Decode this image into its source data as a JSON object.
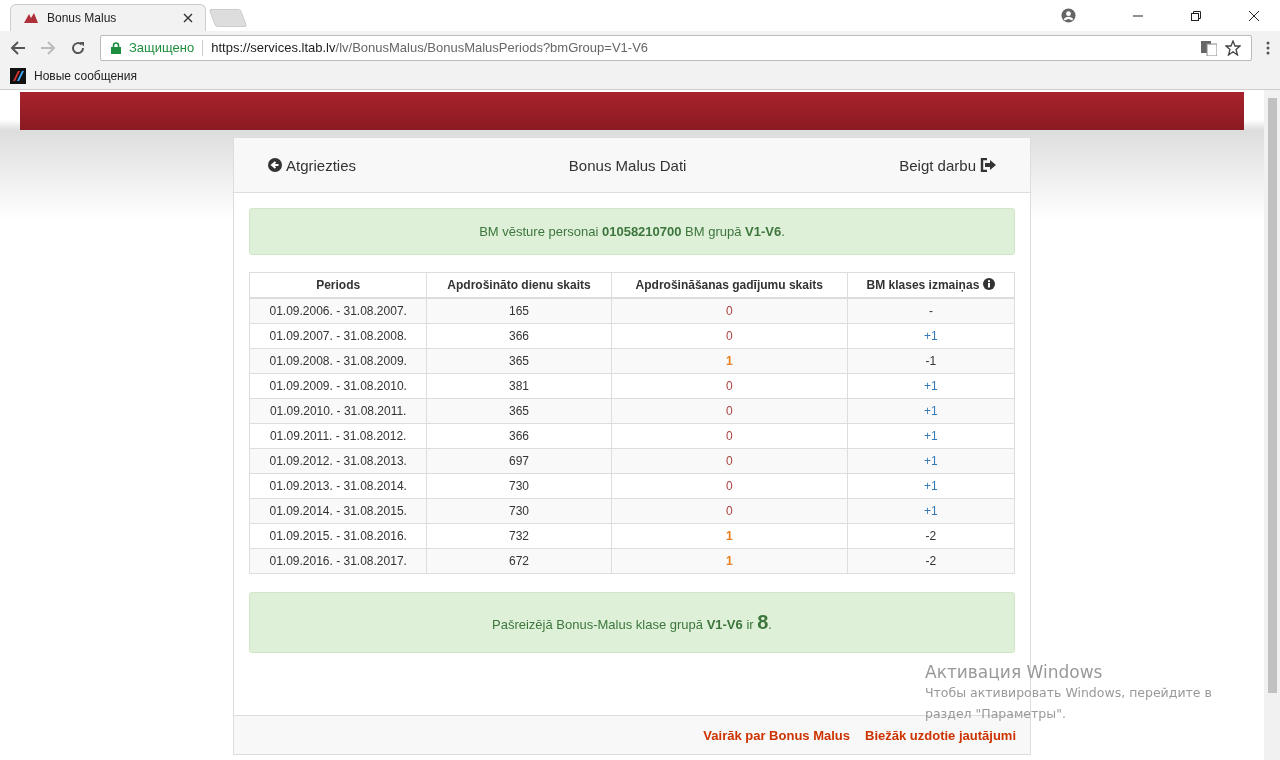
{
  "browser": {
    "tab_title": "Bonus Malus",
    "secure_label": "Защищено",
    "url_host": "https://services.ltab.lv",
    "url_path": "/lv/BonusMalus/BonusMalusPeriods?bmGroup=V1-V6",
    "bookmark": "Новые сообщения"
  },
  "page": {
    "nav": {
      "back": "Atgriezties",
      "title": "Bonus Malus Dati",
      "logout": "Beigt darbu"
    },
    "info_alert": "BM vēsture personai **01058210700** BM grupā **V1-V6**.",
    "table": {
      "columns": [
        "Periods",
        "Apdrošināto dienu skaits",
        "Apdrošināšanas gadījumu skaits",
        "BM klases izmaiņas"
      ],
      "rows": [
        {
          "period": "01.09.2006. - 31.08.2007.",
          "days": "165",
          "claims": "0",
          "claims_highlight": false,
          "change": "-",
          "change_positive": false
        },
        {
          "period": "01.09.2007. - 31.08.2008.",
          "days": "366",
          "claims": "0",
          "claims_highlight": false,
          "change": "+1",
          "change_positive": true
        },
        {
          "period": "01.09.2008. - 31.08.2009.",
          "days": "365",
          "claims": "1",
          "claims_highlight": true,
          "change": "-1",
          "change_positive": false
        },
        {
          "period": "01.09.2009. - 31.08.2010.",
          "days": "381",
          "claims": "0",
          "claims_highlight": false,
          "change": "+1",
          "change_positive": true
        },
        {
          "period": "01.09.2010. - 31.08.2011.",
          "days": "365",
          "claims": "0",
          "claims_highlight": false,
          "change": "+1",
          "change_positive": true
        },
        {
          "period": "01.09.2011. - 31.08.2012.",
          "days": "366",
          "claims": "0",
          "claims_highlight": false,
          "change": "+1",
          "change_positive": true
        },
        {
          "period": "01.09.2012. - 31.08.2013.",
          "days": "697",
          "claims": "0",
          "claims_highlight": false,
          "change": "+1",
          "change_positive": true
        },
        {
          "period": "01.09.2013. - 31.08.2014.",
          "days": "730",
          "claims": "0",
          "claims_highlight": false,
          "change": "+1",
          "change_positive": true
        },
        {
          "period": "01.09.2014. - 31.08.2015.",
          "days": "730",
          "claims": "0",
          "claims_highlight": false,
          "change": "+1",
          "change_positive": true
        },
        {
          "period": "01.09.2015. - 31.08.2016.",
          "days": "732",
          "claims": "1",
          "claims_highlight": true,
          "change": "-2",
          "change_positive": false
        },
        {
          "period": "01.09.2016. - 31.08.2017.",
          "days": "672",
          "claims": "1",
          "claims_highlight": true,
          "change": "-2",
          "change_positive": false
        }
      ]
    },
    "result_alert": {
      "text": "Pašreizējā Bonus-Malus klase grupā **V1-V6** ir",
      "value": "8",
      "end": "."
    },
    "footer_links": [
      "Vairāk par Bonus Malus",
      "Biežāk uzdotie jautājumi"
    ]
  },
  "os_notice": {
    "title": "Активация Windows",
    "text": "Чтобы активировать Windows, перейдите в раздел \"Параметры\"."
  }
}
